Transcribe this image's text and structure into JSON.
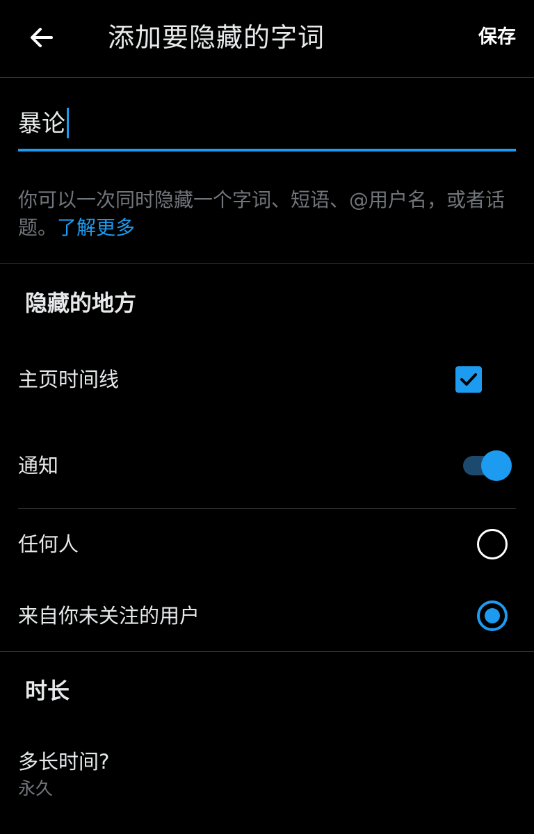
{
  "header": {
    "title": "添加要隐藏的字词",
    "save_label": "保存",
    "back_icon": "arrow-left-icon"
  },
  "input": {
    "value": "暴论"
  },
  "help": {
    "text": "你可以一次同时隐藏一个字词、短语、@用户名，或者话题。",
    "link_label": "了解更多"
  },
  "mute_from": {
    "title": "隐藏的地方",
    "home_timeline": {
      "label": "主页时间线",
      "checked": true
    },
    "notifications": {
      "label": "通知",
      "enabled": true
    }
  },
  "audience": {
    "anyone": {
      "label": "任何人",
      "selected": false
    },
    "not_following": {
      "label": "来自你未关注的用户",
      "selected": true
    }
  },
  "duration": {
    "title": "时长",
    "label": "多长时间?",
    "value": "永久"
  },
  "colors": {
    "accent": "#1d9bf0",
    "background": "#000000",
    "text_primary": "#e7e9ea",
    "text_secondary": "#71767b",
    "divider": "#2f3336"
  }
}
